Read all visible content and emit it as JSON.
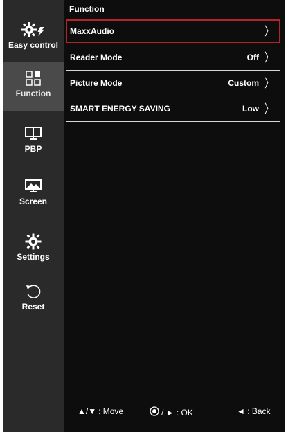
{
  "sidebar": {
    "items": [
      {
        "label": "Easy control",
        "icon": "easy-control-icon"
      },
      {
        "label": "Function",
        "icon": "function-icon"
      },
      {
        "label": "PBP",
        "icon": "pbp-icon"
      },
      {
        "label": "Screen",
        "icon": "screen-icon"
      },
      {
        "label": "Settings",
        "icon": "settings-gear-icon"
      },
      {
        "label": "Reset",
        "icon": "reset-icon"
      }
    ],
    "active_index": 1
  },
  "panel": {
    "title": "Function",
    "rows": [
      {
        "label": "MaxxAudio",
        "value": ""
      },
      {
        "label": "Reader Mode",
        "value": "Off"
      },
      {
        "label": "Picture Mode",
        "value": "Custom"
      },
      {
        "label": "SMART ENERGY SAVING",
        "value": "Low"
      }
    ],
    "selected_index": 0,
    "chevron": "〉"
  },
  "footer": {
    "move": ": Move",
    "move_arrows": "▲/▼",
    "ok": "/ ► : OK",
    "back": "◄ : Back"
  },
  "colors": {
    "selection_border": "#b5222a",
    "sidebar_bg": "#2a2a2a",
    "active_bg": "#4a4a4a",
    "panel_bg": "#0d0d0d"
  }
}
